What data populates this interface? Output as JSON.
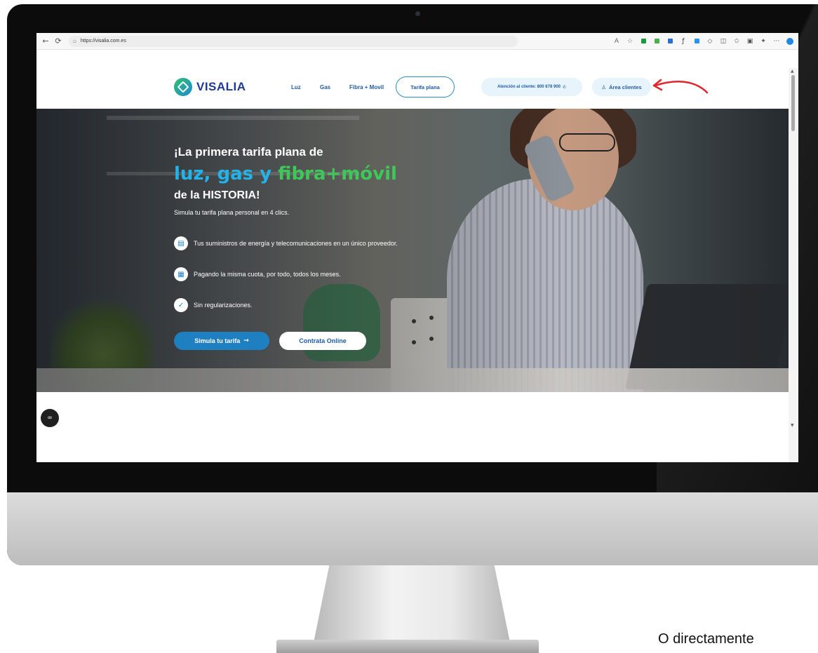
{
  "browser": {
    "url": "https://visalia.com.es",
    "icons": [
      "back-icon",
      "refresh-icon",
      "lock-icon",
      "read-aloud-icon",
      "favorite-icon",
      "more-icon"
    ]
  },
  "site": {
    "brand": "VISALIA",
    "nav": {
      "luz": "Luz",
      "gas": "Gas",
      "fibra": "Fibra + Movil",
      "tarifa": "Tarifa plana",
      "atencion": "Atención al cliente: 800 678 900",
      "area": "Área clientes"
    },
    "accent_color": "#1e7fc1",
    "green_color": "#3fc85a"
  },
  "hero": {
    "line1": "¡La primera tarifa plana de",
    "line2_a": "luz, gas y ",
    "line2_b": "fibra+móvil",
    "line3": "de la HISTORIA!",
    "subtitle": "Simula tu tarifa plana personal en 4 clics.",
    "features": [
      "Tus suministros de energía y telecomunicaciones en un único proveedor.",
      "Pagando la misma cuota, por todo, todos los meses.",
      "Sin regularizaciones."
    ],
    "btn_simula": "Simula tu tarifa",
    "btn_contrata": "Contrata Online"
  },
  "caption": "O directamente"
}
